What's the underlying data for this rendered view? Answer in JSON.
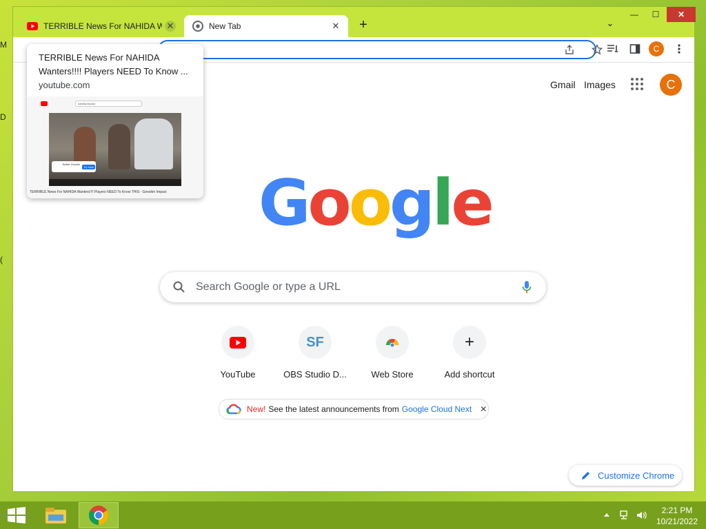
{
  "desktop": {
    "edge_chars": [
      "M",
      "D",
      "("
    ]
  },
  "window": {
    "minimize": "—",
    "maximize": "☐",
    "close": "✕"
  },
  "tabs": [
    {
      "title": "TERRIBLE News For NAHIDA Wanters!!!! Players NEED To Know ...",
      "close": "✕",
      "icon": "youtube-icon"
    },
    {
      "title": "New Tab",
      "close": "✕",
      "icon": "chrome-icon"
    }
  ],
  "new_tab_label": "+",
  "tab_search_label": "⌄",
  "toolbar": {
    "avatar_letter": "C"
  },
  "ntp": {
    "gmail": "Gmail",
    "images": "Images",
    "avatar_letter": "C",
    "search_placeholder": "Search Google or type a URL",
    "shortcuts": [
      {
        "label": "YouTube",
        "icon": "youtube-icon"
      },
      {
        "label": "OBS Studio D...",
        "icon_text": "SF"
      },
      {
        "label": "Web Store",
        "icon": "chrome-web-store-icon"
      },
      {
        "label": "Add shortcut",
        "icon_text": "+"
      }
    ],
    "chip": {
      "new": "New!",
      "text": "See the latest announcements from",
      "link": "Google Cloud Next",
      "close": "✕"
    },
    "customize": "Customize Chrome"
  },
  "hovercard": {
    "title": "TERRIBLE News For NAHIDA Wanters!!!! Players NEED To Know ...",
    "domain": "youtube.com",
    "thumb": {
      "search": "nahida impact",
      "caption": "TERRIBLE News For NAHIDA Wanters!!!! Players NEED To Know THIS - Genshin Impact",
      "ad_title": "Better Grades",
      "ad_button": "Try Now"
    }
  },
  "taskbar": {
    "time": "2:21 PM",
    "date": "10/21/2022"
  },
  "colors": {
    "accent": "#1a73e8",
    "avatar": "#e8710a",
    "window_frame": "#c5e53d",
    "taskbar": "#77a01c"
  }
}
